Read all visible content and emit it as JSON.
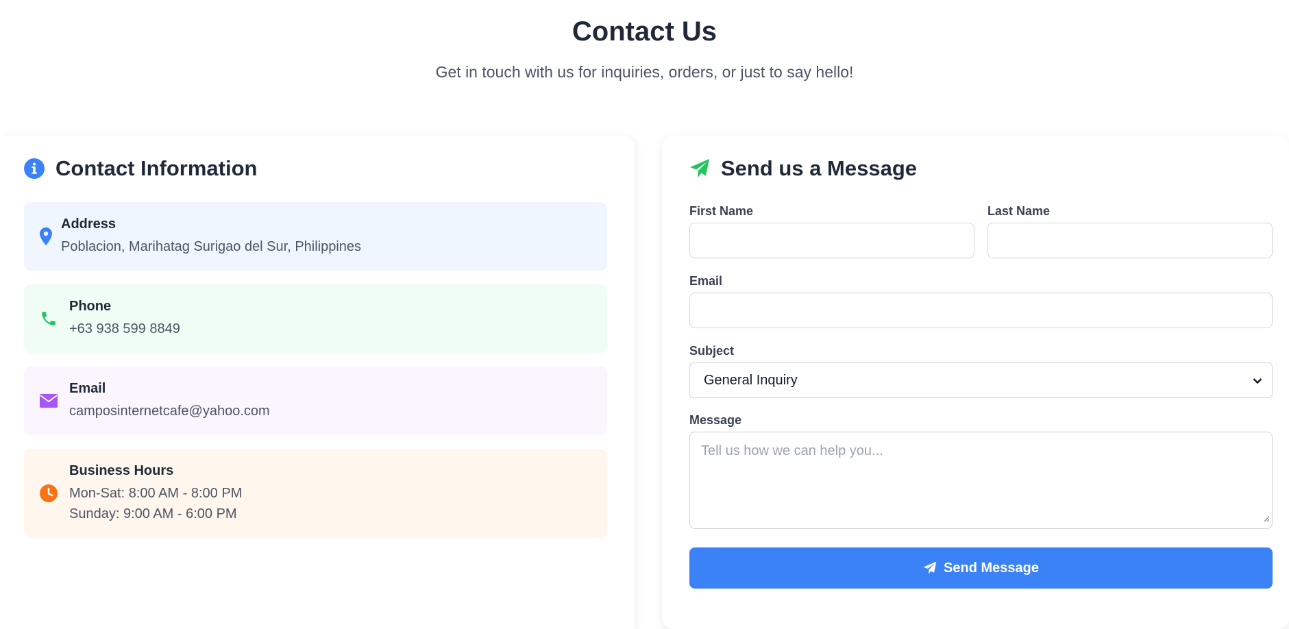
{
  "header": {
    "title": "Contact Us",
    "subtitle": "Get in touch with us for inquiries, orders, or just to say hello!"
  },
  "contact_info": {
    "title": "Contact Information",
    "title_icon": "info-icon",
    "items": [
      {
        "label": "Address",
        "values": [
          "Poblacion, Marihatag Surigao del Sur, Philippines"
        ],
        "icon": "map-pin-icon",
        "bg": "#eff6ff",
        "icon_color": "#3b82f6"
      },
      {
        "label": "Phone",
        "values": [
          "+63 938 599 8849"
        ],
        "icon": "phone-icon",
        "bg": "#f0fdf4",
        "icon_color": "#22c55e"
      },
      {
        "label": "Email",
        "values": [
          "camposinternetcafe@yahoo.com"
        ],
        "icon": "envelope-icon",
        "bg": "#faf5ff",
        "icon_color": "#a855f7"
      },
      {
        "label": "Business Hours",
        "values": [
          "Mon-Sat: 8:00 AM - 8:00 PM",
          "Sunday: 9:00 AM - 6:00 PM"
        ],
        "icon": "clock-icon",
        "bg": "#fff7ed",
        "icon_color": "#f97316"
      }
    ]
  },
  "message_form": {
    "title": "Send us a Message",
    "title_icon": "paper-plane-icon",
    "first_name_label": "First Name",
    "first_name_value": "",
    "last_name_label": "Last Name",
    "last_name_value": "",
    "email_label": "Email",
    "email_value": "",
    "subject_label": "Subject",
    "subject_selected": "General Inquiry",
    "message_label": "Message",
    "message_placeholder": "Tell us how we can help you...",
    "submit_label": "Send Message",
    "accent": "#3b82f6",
    "plane_color": "#22c55e"
  }
}
